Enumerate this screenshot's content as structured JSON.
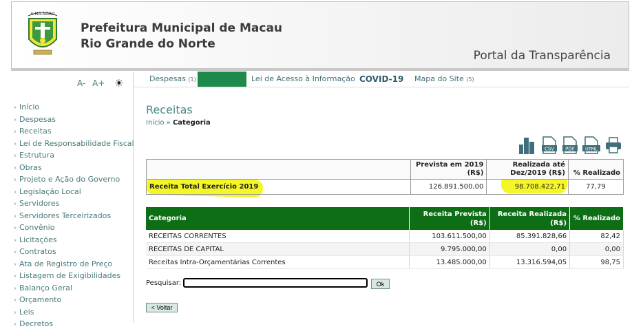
{
  "header": {
    "org_line1": "Prefeitura Municipal de Macau",
    "org_line2": "Rio Grande do Norte",
    "portal": "Portal da Transparência",
    "logo_text": "A-MA-NGAO"
  },
  "font_controls": {
    "decrease": "A-",
    "increase": "A+",
    "contrast_icon": "sun-icon"
  },
  "sidebar": {
    "items": [
      "Início",
      "Despesas",
      "Receitas",
      "Lei de Responsabilidade Fiscal",
      "Estrutura",
      "Obras",
      "Projeto e Ação do Governo",
      "Legislação Local",
      "Servidores",
      "Servidores Terceirizados",
      "Convênio",
      "Licitações",
      "Contratos",
      "Ata de Registro de Preço",
      "Listagem de Exigibilidades",
      "Balanço Geral",
      "Orçamento",
      "Leis",
      "Decretos"
    ]
  },
  "nav": {
    "despesas": "Despesas",
    "despesas_count": "(1)",
    "receitas": "Receitas",
    "lei_acesso": "Lei de Acesso à Informação",
    "covid": "COVID-19",
    "mapa": "Mapa do Site",
    "mapa_count": "(5)"
  },
  "page": {
    "title": "Receitas",
    "breadcrumb_home": "Início",
    "breadcrumb_sep": "»",
    "breadcrumb_current": "Categoria"
  },
  "export_icons": {
    "chart": "chart-icon",
    "csv": "CSV",
    "pdf": "PDF",
    "html": "HTML",
    "print": "print-icon"
  },
  "summary": {
    "col_prevista": "Prevista em 2019 (R$)",
    "col_realizada": "Realizada até Dez/2019 (R$)",
    "col_percent": "% Realizado",
    "row_label": "Receita Total Exercício 2019",
    "prevista": "126.891.500,00",
    "realizada": "98.708.422,71",
    "percent": "77,79"
  },
  "category_table": {
    "headers": [
      "Categoria",
      "Receita Prevista (R$)",
      "Receita Realizada (R$)",
      "% Realizado"
    ],
    "rows": [
      [
        "RECEITAS CORRENTES",
        "103.611.500,00",
        "85.391.828,66",
        "82,42"
      ],
      [
        "RECEITAS DE CAPITAL",
        "9.795.000,00",
        "0,00",
        "0,00"
      ],
      [
        "Receitas Intra-Orçamentárias Correntes",
        "13.485.000,00",
        "13.316.594,05",
        "98,75"
      ]
    ]
  },
  "search": {
    "label": "Pesquisar:",
    "value": "",
    "button": "Ok"
  },
  "back_button": "< Voltar",
  "colors": {
    "header_green": "#0d6e16",
    "highlight": "#f3f400",
    "link": "#4a7a7a"
  }
}
